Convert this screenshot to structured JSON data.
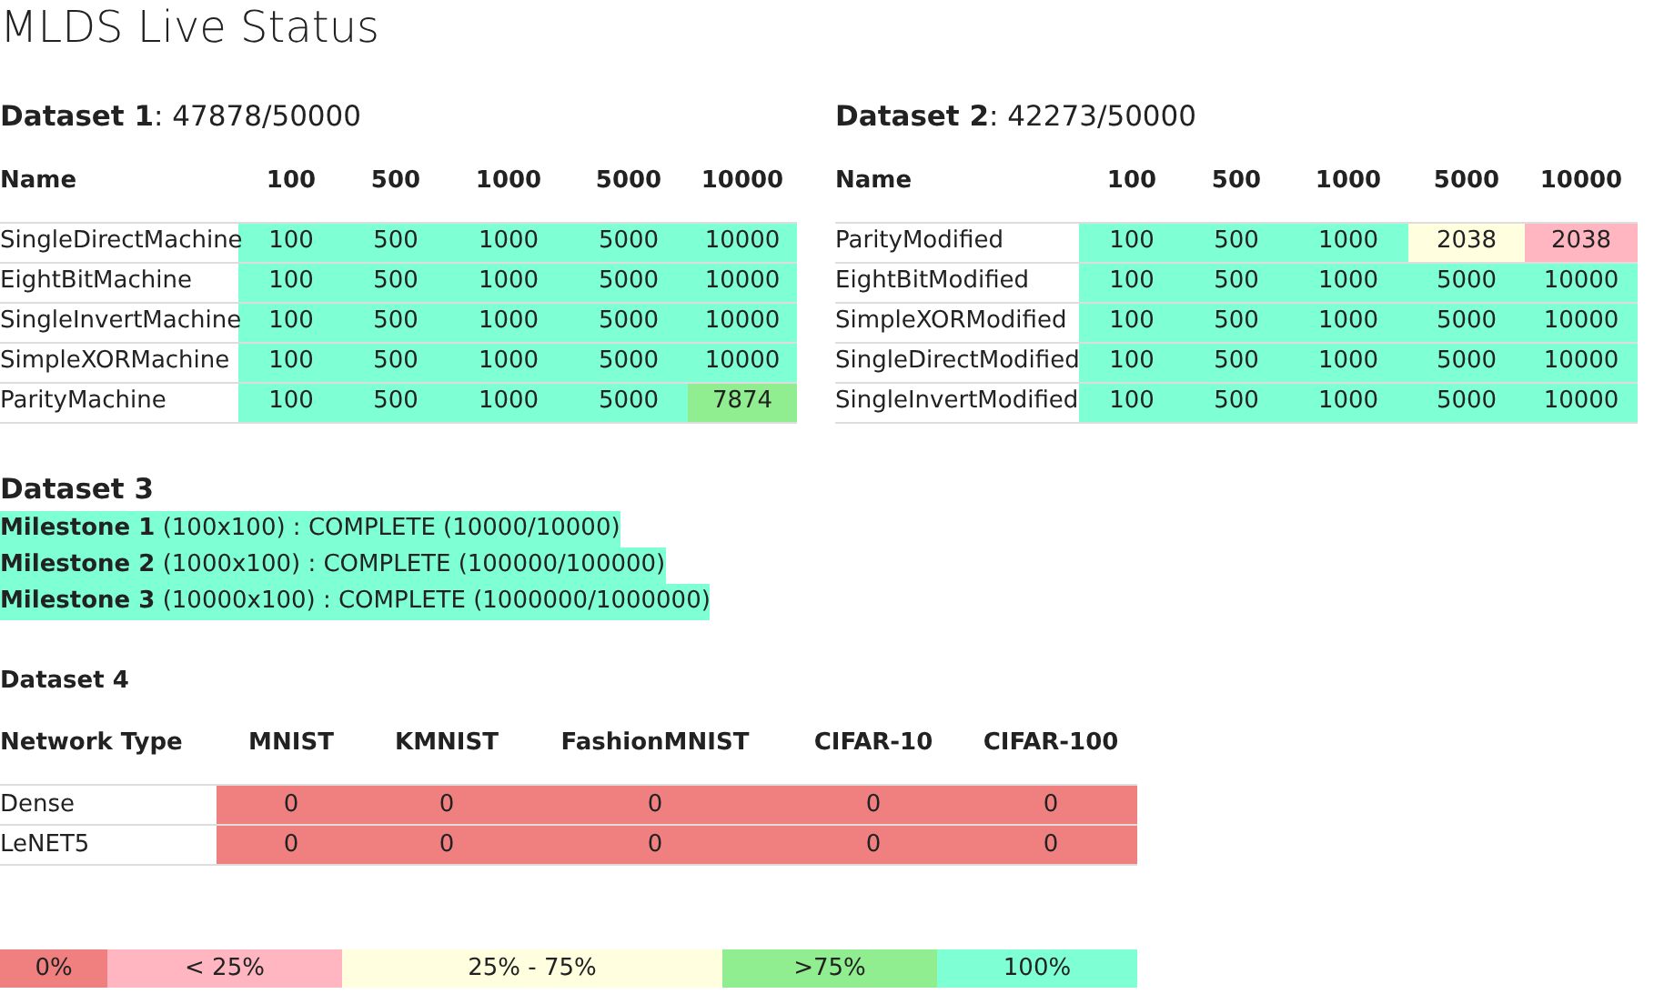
{
  "title": "MLDS Live Status",
  "datasets": [
    {
      "heading": "**Dataset 1**: 47878/50000",
      "columns": [
        "Name",
        "100",
        "500",
        "1000",
        "5000",
        "10000"
      ],
      "rows": [
        {
          "cells": [
            {
              "text": "SingleDirectMachine"
            },
            {
              "text": "100",
              "color": "#7fffd4"
            },
            {
              "text": "500",
              "color": "#7fffd4"
            },
            {
              "text": "1000",
              "color": "#7fffd4"
            },
            {
              "text": "5000",
              "color": "#7fffd4"
            },
            {
              "text": "10000",
              "color": "#7fffd4"
            }
          ]
        },
        {
          "cells": [
            {
              "text": "EightBitMachine"
            },
            {
              "text": "100",
              "color": "#7fffd4"
            },
            {
              "text": "500",
              "color": "#7fffd4"
            },
            {
              "text": "1000",
              "color": "#7fffd4"
            },
            {
              "text": "5000",
              "color": "#7fffd4"
            },
            {
              "text": "10000",
              "color": "#7fffd4"
            }
          ]
        },
        {
          "cells": [
            {
              "text": "SingleInvertMachine"
            },
            {
              "text": "100",
              "color": "#7fffd4"
            },
            {
              "text": "500",
              "color": "#7fffd4"
            },
            {
              "text": "1000",
              "color": "#7fffd4"
            },
            {
              "text": "5000",
              "color": "#7fffd4"
            },
            {
              "text": "10000",
              "color": "#7fffd4"
            }
          ]
        },
        {
          "cells": [
            {
              "text": "SimpleXORMachine"
            },
            {
              "text": "100",
              "color": "#7fffd4"
            },
            {
              "text": "500",
              "color": "#7fffd4"
            },
            {
              "text": "1000",
              "color": "#7fffd4"
            },
            {
              "text": "5000",
              "color": "#7fffd4"
            },
            {
              "text": "10000",
              "color": "#7fffd4"
            }
          ]
        },
        {
          "cells": [
            {
              "text": "ParityMachine"
            },
            {
              "text": "100",
              "color": "#7fffd4"
            },
            {
              "text": "500",
              "color": "#7fffd4"
            },
            {
              "text": "1000",
              "color": "#7fffd4"
            },
            {
              "text": "5000",
              "color": "#7fffd4"
            },
            {
              "text": "7874",
              "color": "#90ee90"
            }
          ]
        }
      ]
    },
    {
      "heading": "**Dataset 2**: 42273/50000",
      "columns": [
        "Name",
        "100",
        "500",
        "1000",
        "5000",
        "10000"
      ],
      "rows": [
        {
          "cells": [
            {
              "text": "ParityModified"
            },
            {
              "text": "100",
              "color": "#7fffd4"
            },
            {
              "text": "500",
              "color": "#7fffd4"
            },
            {
              "text": "1000",
              "color": "#7fffd4"
            },
            {
              "text": "2038",
              "color": "#ffffe0"
            },
            {
              "text": "2038",
              "color": "#ffb6c1"
            }
          ]
        },
        {
          "cells": [
            {
              "text": "EightBitModified"
            },
            {
              "text": "100",
              "color": "#7fffd4"
            },
            {
              "text": "500",
              "color": "#7fffd4"
            },
            {
              "text": "1000",
              "color": "#7fffd4"
            },
            {
              "text": "5000",
              "color": "#7fffd4"
            },
            {
              "text": "10000",
              "color": "#7fffd4"
            }
          ]
        },
        {
          "cells": [
            {
              "text": "SimpleXORModified"
            },
            {
              "text": "100",
              "color": "#7fffd4"
            },
            {
              "text": "500",
              "color": "#7fffd4"
            },
            {
              "text": "1000",
              "color": "#7fffd4"
            },
            {
              "text": "5000",
              "color": "#7fffd4"
            },
            {
              "text": "10000",
              "color": "#7fffd4"
            }
          ]
        },
        {
          "cells": [
            {
              "text": "SingleDirectModified"
            },
            {
              "text": "100",
              "color": "#7fffd4"
            },
            {
              "text": "500",
              "color": "#7fffd4"
            },
            {
              "text": "1000",
              "color": "#7fffd4"
            },
            {
              "text": "5000",
              "color": "#7fffd4"
            },
            {
              "text": "10000",
              "color": "#7fffd4"
            }
          ]
        },
        {
          "cells": [
            {
              "text": "SingleInvertModified"
            },
            {
              "text": "100",
              "color": "#7fffd4"
            },
            {
              "text": "500",
              "color": "#7fffd4"
            },
            {
              "text": "1000",
              "color": "#7fffd4"
            },
            {
              "text": "5000",
              "color": "#7fffd4"
            },
            {
              "text": "10000",
              "color": "#7fffd4"
            }
          ]
        }
      ]
    }
  ],
  "dataset_3": {
    "heading": "Dataset 3",
    "milestones": [
      {
        "text": "**Milestone 1** (100x100) : COMPLETE (10000/10000)",
        "color": "#7fffd4"
      },
      {
        "text": "**Milestone 2** (1000x100) : COMPLETE (100000/100000)",
        "color": "#7fffd4"
      },
      {
        "text": "**Milestone 3** (10000x100) : COMPLETE (1000000/1000000)",
        "color": "#7fffd4"
      }
    ]
  },
  "dataset_4": {
    "heading": "Dataset 4",
    "columns": [
      "Network Type",
      "MNIST",
      "KMNIST",
      "FashionMNIST",
      "CIFAR-10",
      "CIFAR-100"
    ],
    "rows": [
      {
        "cells": [
          {
            "text": "Dense"
          },
          {
            "text": "0",
            "color": "#f08080"
          },
          {
            "text": "0",
            "color": "#f08080"
          },
          {
            "text": "0",
            "color": "#f08080"
          },
          {
            "text": "0",
            "color": "#f08080"
          },
          {
            "text": "0",
            "color": "#f08080"
          }
        ]
      },
      {
        "cells": [
          {
            "text": "LeNET5"
          },
          {
            "text": "0",
            "color": "#f08080"
          },
          {
            "text": "0",
            "color": "#f08080"
          },
          {
            "text": "0",
            "color": "#f08080"
          },
          {
            "text": "0",
            "color": "#f08080"
          },
          {
            "text": "0",
            "color": "#f08080"
          }
        ]
      }
    ]
  },
  "legend": [
    {
      "text": "0%",
      "color": "#f08080"
    },
    {
      "text": "< 25%",
      "color": "#ffb6c1"
    },
    {
      "text": "25% - 75%",
      "color": "#ffffe0"
    },
    {
      "text": ">75%",
      "color": "#90ee90"
    },
    {
      "text": "100%",
      "color": "#7fffd4"
    }
  ]
}
